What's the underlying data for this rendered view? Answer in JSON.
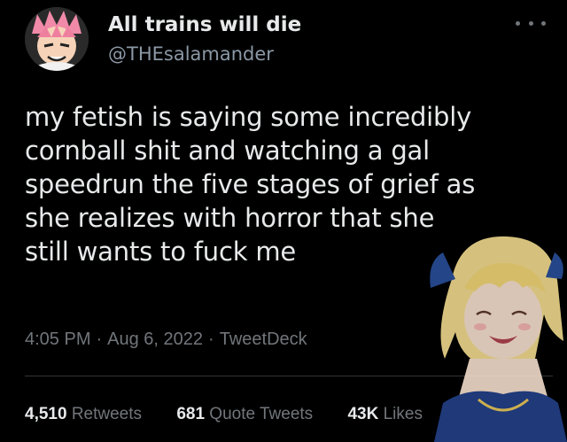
{
  "header": {
    "display_name": "All trains will die",
    "handle": "@THEsalamander"
  },
  "icons": {
    "avatar": "avatar-image",
    "more": "more-options-icon"
  },
  "tweet": {
    "lines": [
      "my fetish is saying some incredibly",
      "cornball shit and watching a gal",
      "speedrun the five stages of grief as",
      "she realizes with horror that she",
      "still wants to fuck me"
    ],
    "time": "4:05 PM",
    "date": "Aug 6, 2022",
    "source": "TweetDeck",
    "separator": "·"
  },
  "stats": {
    "retweets_count": "4,510",
    "retweets_label": "Retweets",
    "quotes_count": "681",
    "quotes_label": "Quote Tweets",
    "likes_count": "43K",
    "likes_label": "Likes"
  },
  "colors": {
    "background": "#000000",
    "primary_text": "#e7e9ea",
    "secondary_text": "#71767b",
    "divider": "#2f3336"
  }
}
